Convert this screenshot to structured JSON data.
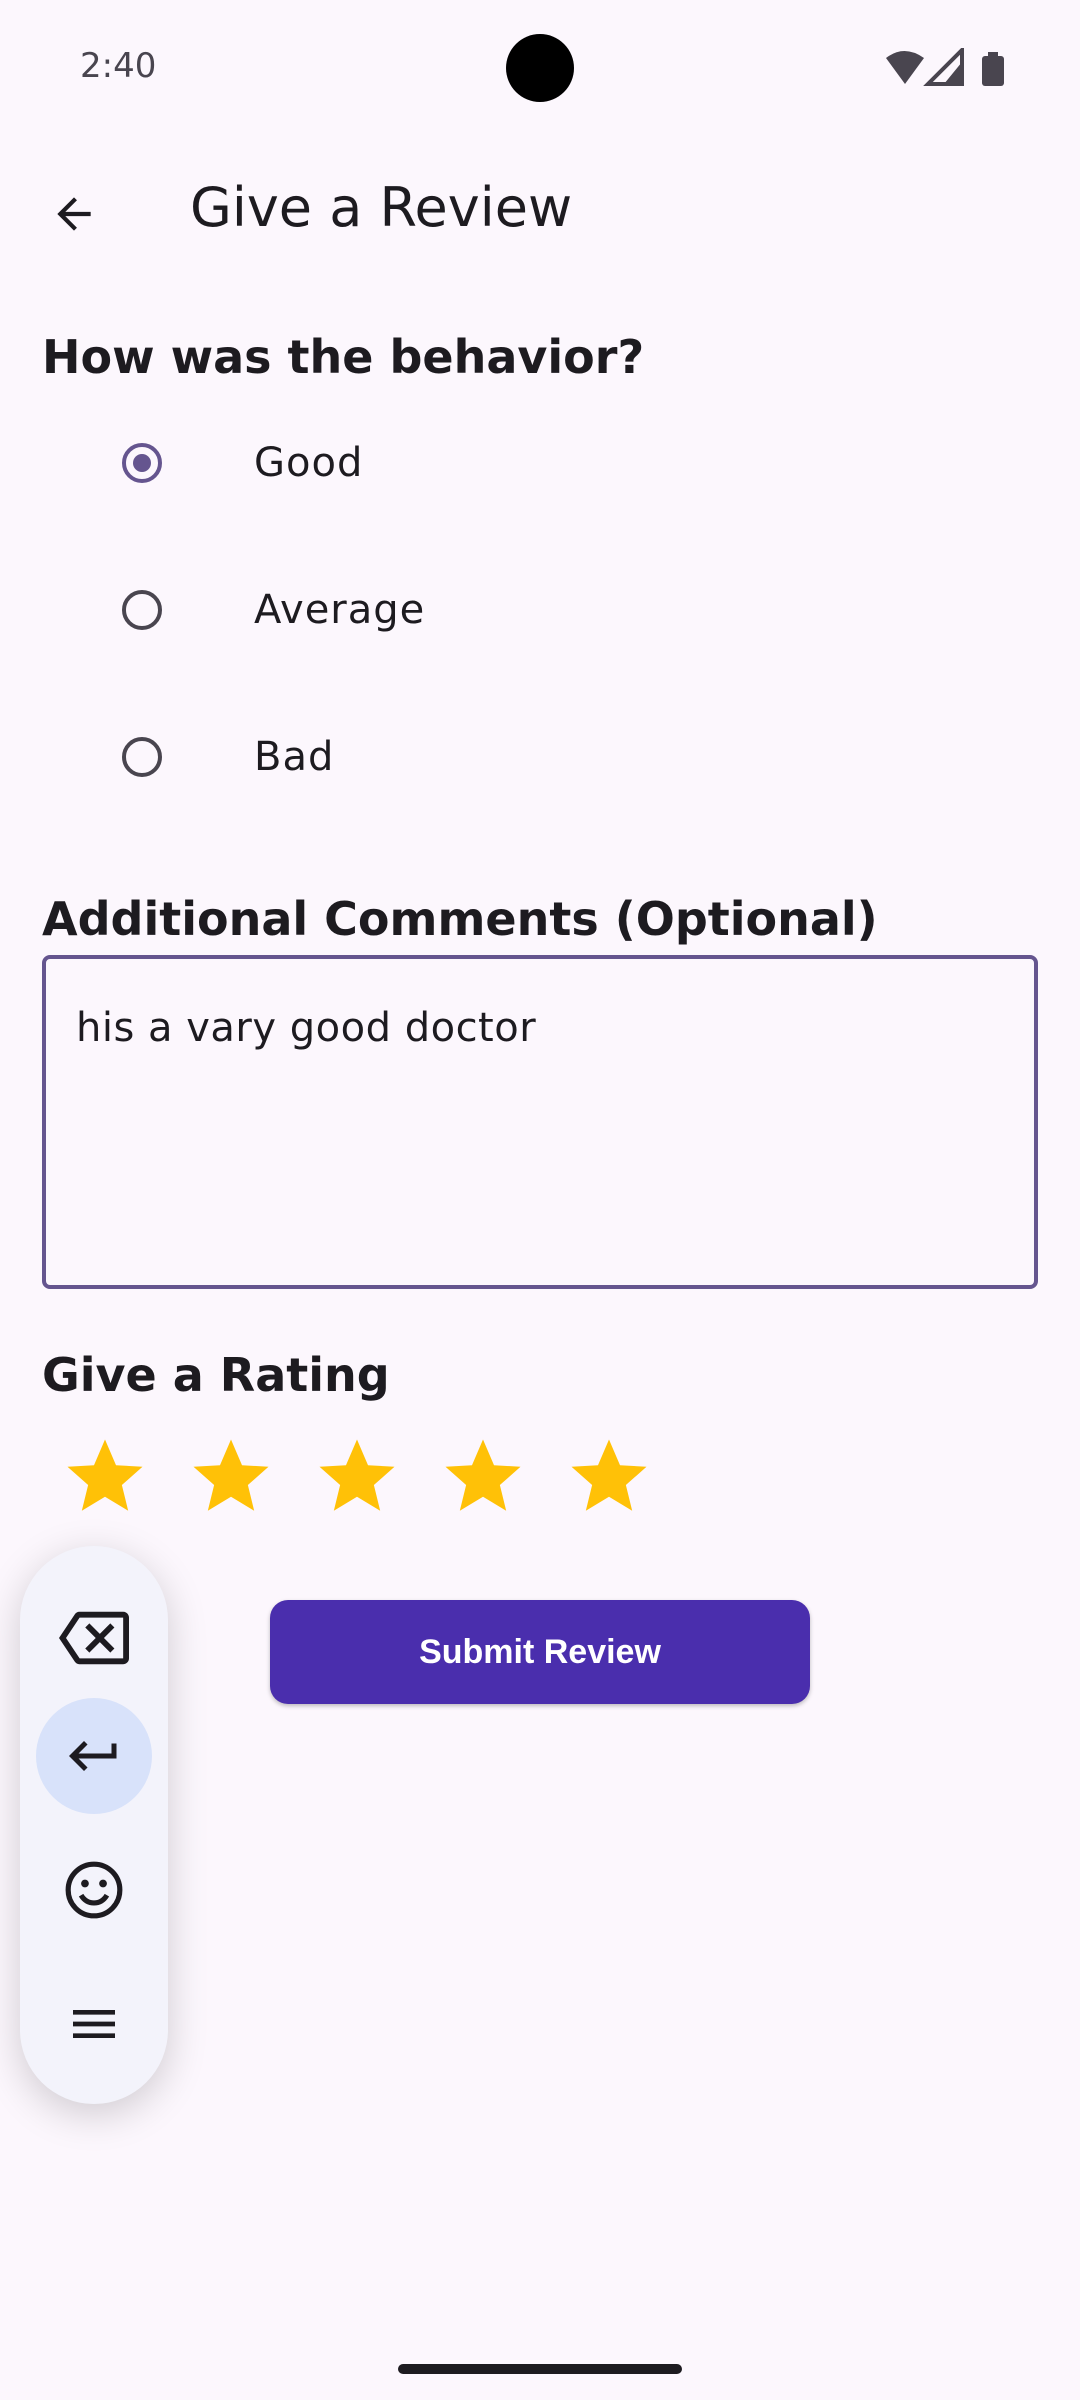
{
  "status_bar": {
    "time": "2:40"
  },
  "app_bar": {
    "title": "Give a Review"
  },
  "behavior": {
    "heading": "How was the behavior?",
    "options": [
      {
        "label": "Good",
        "selected": true
      },
      {
        "label": "Average",
        "selected": false
      },
      {
        "label": "Bad",
        "selected": false
      }
    ]
  },
  "comments": {
    "heading": "Additional Comments (Optional)",
    "value": "his a vary good doctor"
  },
  "rating": {
    "heading": "Give a Rating",
    "value": 5,
    "max": 5,
    "star_color": "#FFC107"
  },
  "submit": {
    "label": "Submit Review"
  },
  "keyboard_toolbar": {
    "items": [
      "backspace-icon",
      "enter-icon",
      "emoji-icon",
      "menu-icon"
    ]
  },
  "colors": {
    "accent": "#65558F",
    "button": "#4A2EAD",
    "background": "#FCF7FD"
  }
}
